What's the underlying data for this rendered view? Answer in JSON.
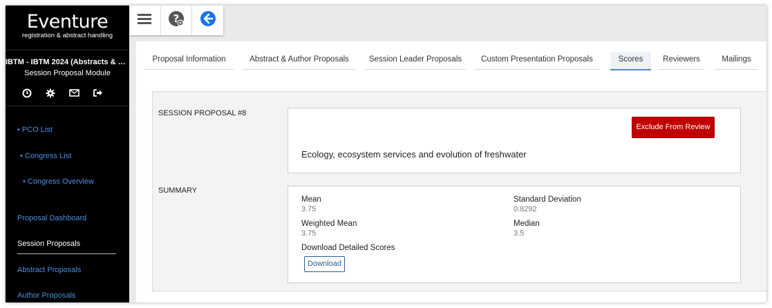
{
  "app": {
    "logo_name": "Eventure",
    "logo_tagline": "registration & abstract handling",
    "event_title": "IBTM - IBTM 2024 (Abstracts & Par...",
    "module_title": "Session Proposal Module"
  },
  "sidebar": {
    "icons": [
      "clock-icon",
      "gear-icon",
      "mail-icon",
      "logout-icon"
    ],
    "links": [
      {
        "label": "• PCO List"
      },
      {
        "label": "• Congress List"
      },
      {
        "label": "• Congress Overview"
      },
      {
        "label": "Proposal Dashboard"
      },
      {
        "label": "Session Proposals"
      },
      {
        "label": "Abstract Proposals"
      },
      {
        "label": "Author Proposals"
      }
    ],
    "active": "Session Proposals"
  },
  "toolbar": {
    "buttons": [
      "menu-icon",
      "help-icon",
      "back-icon"
    ]
  },
  "tabs": [
    {
      "label": "Proposal Information"
    },
    {
      "label": "Abstract & Author Proposals"
    },
    {
      "label": "Session Leader Proposals"
    },
    {
      "label": "Custom Presentation Proposals"
    },
    {
      "label": "Scores"
    },
    {
      "label": "Reviewers"
    },
    {
      "label": "Mailings"
    }
  ],
  "active_tab": "Scores",
  "proposal": {
    "section_label": "SESSION PROPOSAL #8",
    "exclude_label": "Exclude From Review",
    "title": "Ecology, ecosystem services and evolution of freshwater"
  },
  "summary": {
    "section_label": "SUMMARY",
    "mean_label": "Mean",
    "mean_value": "3.75",
    "std_label": "Standard Deviation",
    "std_value": "0.8292",
    "wmean_label": "Weighted Mean",
    "wmean_value": "3.75",
    "median_label": "Median",
    "median_value": "3.5",
    "download_label": "Download Detailed Scores",
    "download_button": "Download"
  },
  "colors": {
    "sidebar_bg": "#000000",
    "link": "#4a90e2",
    "danger": "#c00000",
    "primary_icon": "#1a73e8"
  }
}
